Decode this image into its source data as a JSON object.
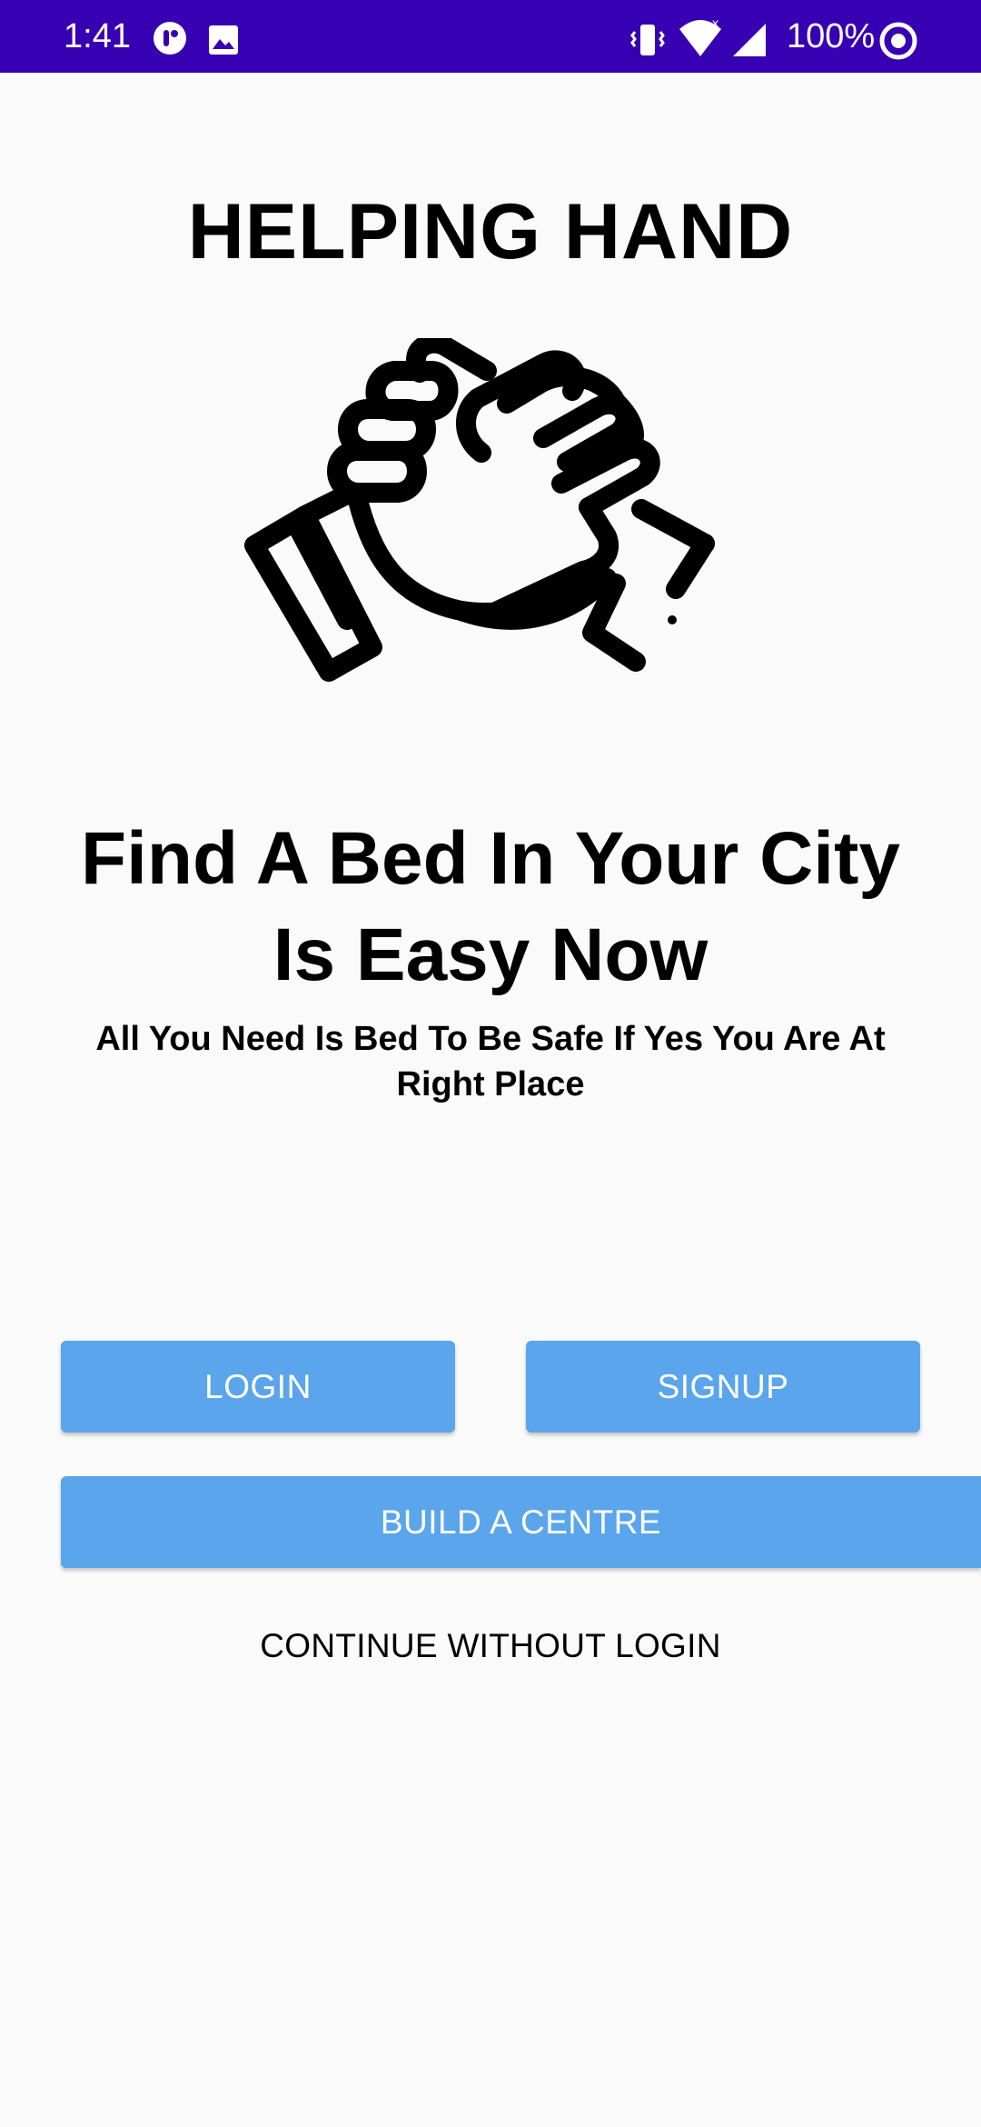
{
  "status_bar": {
    "time": "1:41",
    "battery": "100%",
    "icons": [
      "notification-app-icon",
      "image-icon",
      "vibrate-icon",
      "wifi-icon",
      "signal-icon",
      "battery-ring-icon"
    ]
  },
  "app": {
    "title": "HELPING HAND",
    "hero_icon": "handshake-icon"
  },
  "hero": {
    "headline_line1": "Find A Bed In Your City",
    "headline_line2": "Is Easy Now",
    "subline_line1": "All You Need Is Bed To Be Safe If Yes You Are At",
    "subline_line2": "Right Place"
  },
  "actions": {
    "login_label": "LOGIN",
    "signup_label": "SIGNUP",
    "build_label": "BUILD A CENTRE",
    "continue_label": "CONTINUE WITHOUT LOGIN"
  },
  "colors": {
    "status_bar": "#3700b3",
    "button": "#5aa5eb",
    "background": "#fafafa"
  }
}
